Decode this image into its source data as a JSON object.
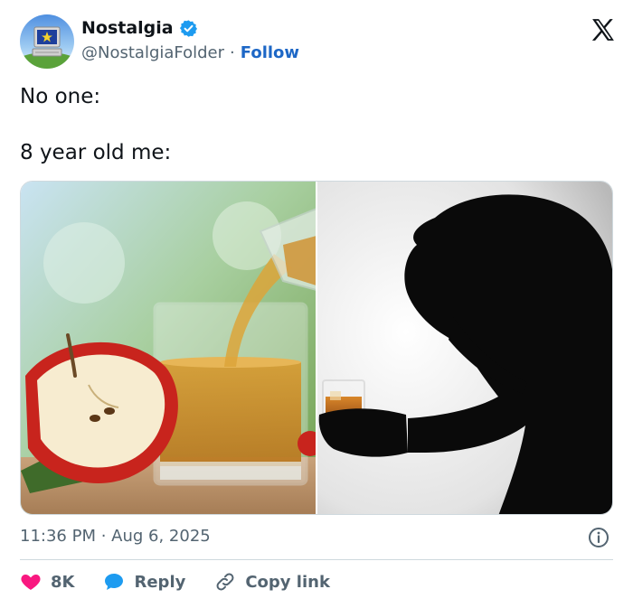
{
  "author": {
    "display_name": "Nostalgia",
    "handle": "@NostalgiaFolder",
    "separator": "·",
    "follow_label": "Follow",
    "verified": true
  },
  "tweet": {
    "lines": [
      "No one:",
      "8 year old me:"
    ]
  },
  "meta": {
    "timestamp": "11:36 PM · Aug 6, 2025"
  },
  "actions": {
    "like_count": "8K",
    "reply_label": "Reply",
    "copy_link_label": "Copy link"
  },
  "colors": {
    "accent_blue": "#1d67c6",
    "verified_blue": "#1d9bf0",
    "like_pink": "#f91880",
    "muted_gray": "#536471",
    "text_dark": "#0f1419",
    "divider": "#cfd9de"
  },
  "icons": {
    "logo": "x-logo-icon",
    "verified": "verified-badge-icon",
    "info": "info-icon",
    "like": "heart-icon",
    "reply": "speech-bubble-icon",
    "copy_link": "link-icon"
  }
}
